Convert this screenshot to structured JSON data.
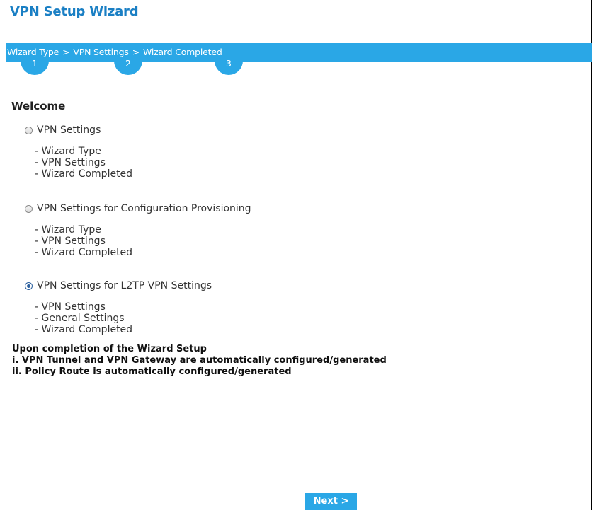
{
  "window": {
    "title": "VPN Setup Wizard"
  },
  "steps": [
    {
      "label": "Wizard Type",
      "number": "1"
    },
    {
      "label": "VPN Settings",
      "number": "2"
    },
    {
      "label": "Wizard Completed",
      "number": "3"
    }
  ],
  "step_separator": ">",
  "welcome_heading": "Welcome",
  "options": [
    {
      "label": "VPN Settings",
      "selected": false,
      "substeps": [
        "- Wizard Type",
        "- VPN Settings",
        "- Wizard Completed"
      ]
    },
    {
      "label": "VPN Settings for Configuration Provisioning",
      "selected": false,
      "substeps": [
        "- Wizard Type",
        "- VPN Settings",
        "- Wizard Completed"
      ]
    },
    {
      "label": "VPN Settings for L2TP VPN Settings",
      "selected": true,
      "substeps": [
        "- VPN Settings",
        "- General Settings",
        "- Wizard Completed"
      ]
    }
  ],
  "completion_notes": [
    "Upon completion of the Wizard Setup",
    "i. VPN Tunnel and VPN Gateway are automatically configured/generated",
    "ii. Policy Route is automatically configured/generated"
  ],
  "buttons": {
    "next_label": "Next >"
  },
  "colors": {
    "accent": "#2aa7e6",
    "title": "#1a7fc4"
  }
}
